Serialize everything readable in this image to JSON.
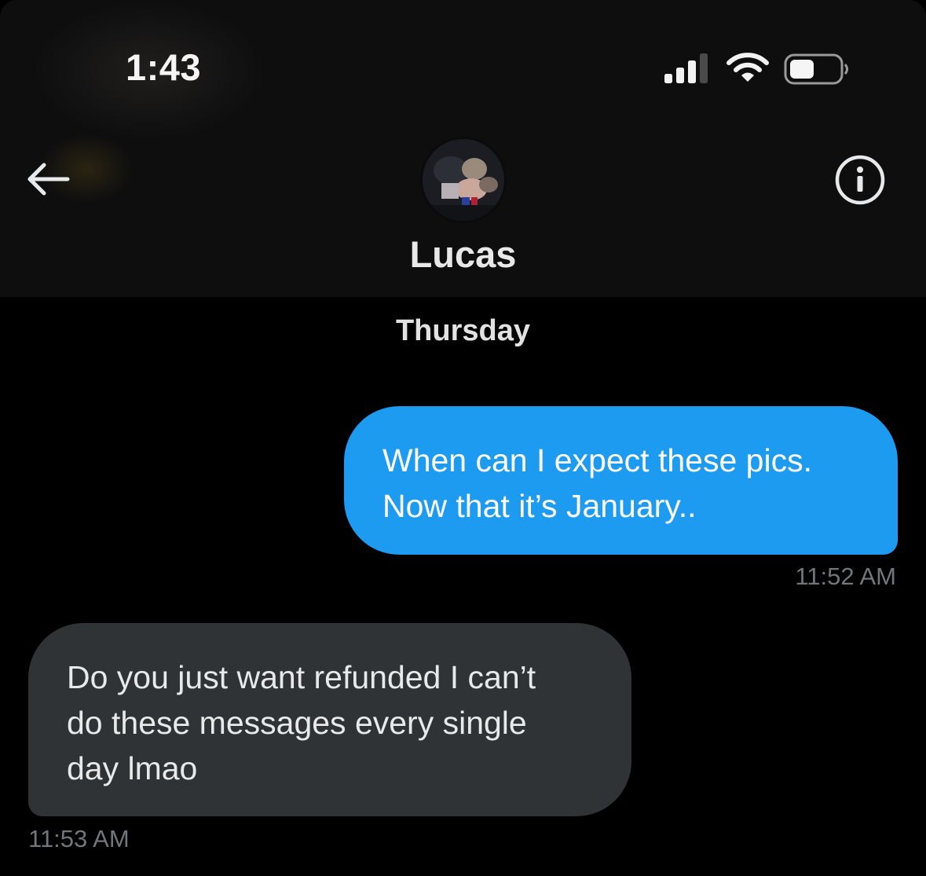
{
  "status_bar": {
    "time": "1:43",
    "signal_icon": "cellular-signal-icon",
    "signal_bars_filled": 3,
    "wifi_icon": "wifi-icon",
    "battery_icon": "battery-icon",
    "battery_level": 0.25
  },
  "header": {
    "back_icon": "back-arrow-icon",
    "contact_name": "Lucas",
    "info_icon": "info-icon"
  },
  "conversation": {
    "day_separator": "Thursday",
    "messages": [
      {
        "direction": "outgoing",
        "lines": [
          "When can I expect these pics.",
          "Now that it’s January.."
        ],
        "timestamp": "11:52 AM"
      },
      {
        "direction": "incoming",
        "lines": [
          "Do you just want refunded I can’t",
          "do these messages every single",
          "day lmao"
        ],
        "timestamp": "11:53 AM"
      }
    ]
  },
  "colors": {
    "background": "#000000",
    "header_background": "#0e0e0f",
    "outgoing_bubble": "#1d9bf0",
    "incoming_bubble": "#2f3336",
    "timestamp": "#71767b"
  }
}
